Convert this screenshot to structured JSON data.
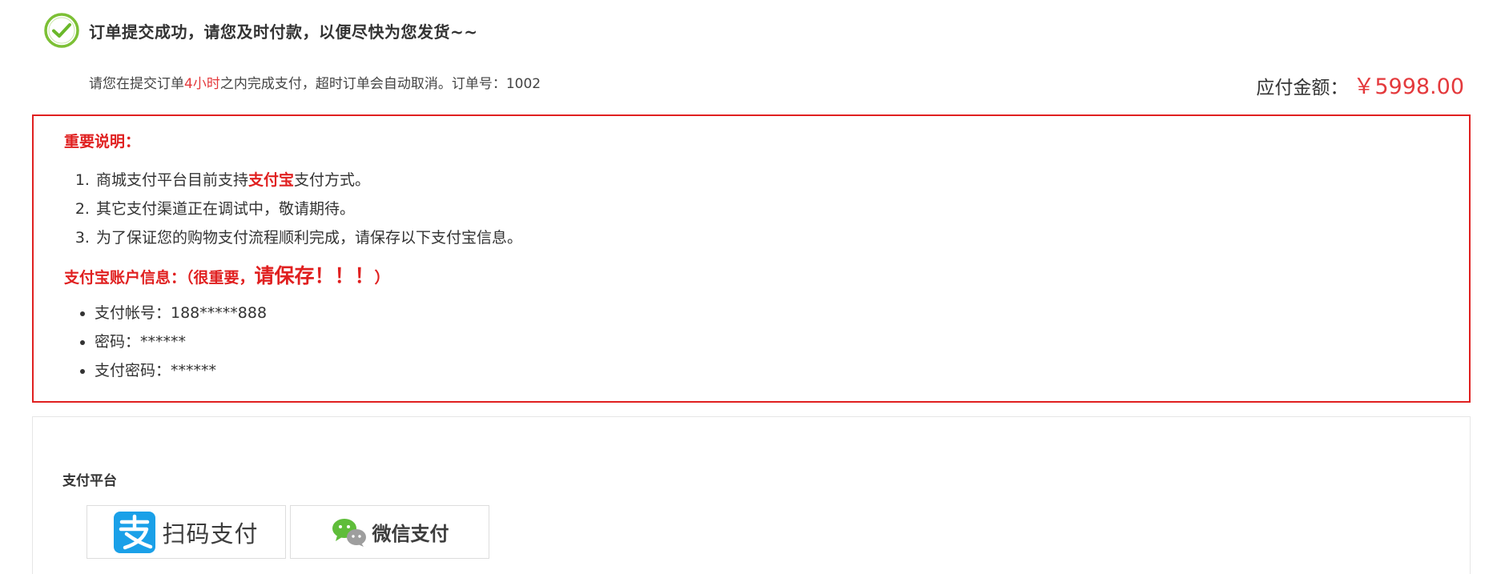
{
  "header": {
    "success_title": "订单提交成功，请您及时付款，以便尽快为您发货~~",
    "notice_prefix": "请您在提交订单",
    "notice_time": "4小时",
    "notice_suffix": "之内完成支付，超时订单会自动取消。订单号：",
    "order_number": "1002",
    "amount_label": "应付金额：",
    "amount_value": "￥5998.00"
  },
  "important": {
    "title": "重要说明：",
    "items": [
      {
        "prefix": "商城支付平台目前支持",
        "highlight": "支付宝",
        "suffix": "支付方式。"
      },
      {
        "text": "其它支付渠道正在调试中，敬请期待。"
      },
      {
        "text": "为了保证您的购物支付流程顺利完成，请保存以下支付宝信息。"
      }
    ],
    "account_title_prefix": "支付宝账户信息：（很重要，",
    "account_title_big": "请保存！！！",
    "account_title_suffix": "）",
    "account_items": [
      "支付帐号：188*****888",
      "密码：******",
      "支付密码：******"
    ]
  },
  "payment": {
    "platform_label": "支付平台",
    "options": [
      {
        "label": "扫码支付",
        "icon": "alipay-icon"
      },
      {
        "label": "微信支付",
        "icon": "wechat-icon"
      }
    ]
  },
  "colors": {
    "accent_red": "#e02020",
    "price_red": "#e4393c",
    "check_green": "#7cc035",
    "alipay_blue": "#1aa0e8",
    "wechat_green": "#5fbd3a"
  }
}
